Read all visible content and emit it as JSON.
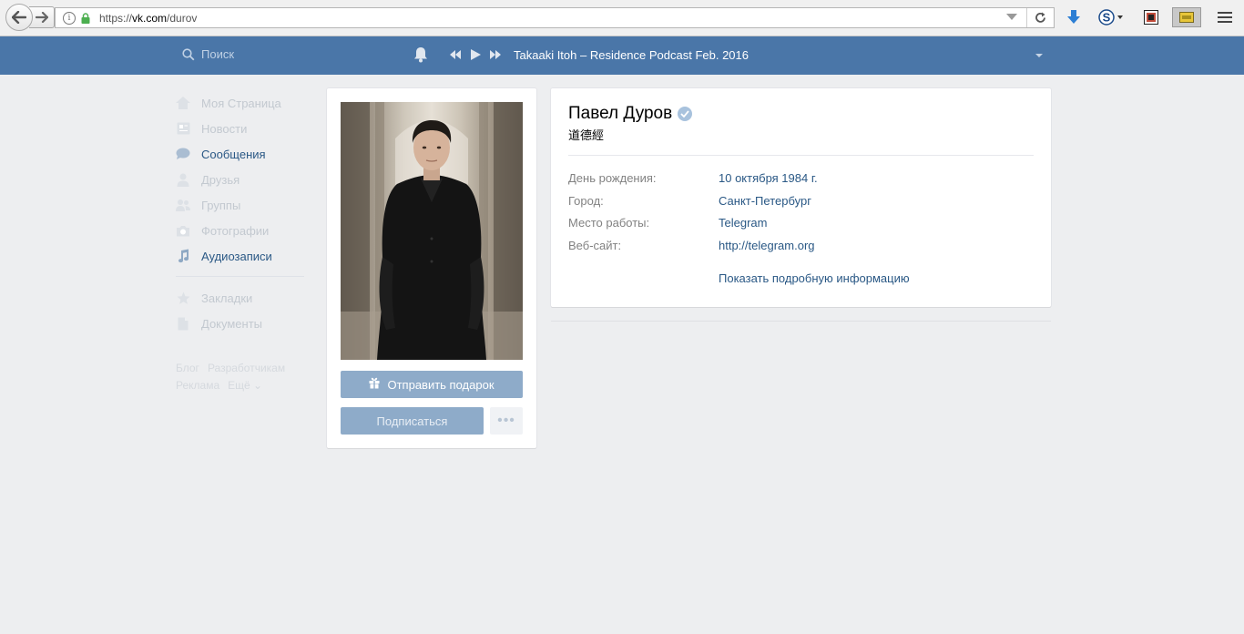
{
  "browser": {
    "url_scheme": "https://",
    "url_host": "vk.com",
    "url_path": "/durov"
  },
  "header": {
    "search_placeholder": "Поиск",
    "now_playing": "Takaaki Itoh – Residence Podcast Feb. 2016"
  },
  "menu": {
    "items": [
      {
        "label": "Моя Страница",
        "icon": "home-icon",
        "active": false
      },
      {
        "label": "Новости",
        "icon": "news-icon",
        "active": false
      },
      {
        "label": "Сообщения",
        "icon": "messages-icon",
        "active": true
      },
      {
        "label": "Друзья",
        "icon": "friends-icon",
        "active": false
      },
      {
        "label": "Группы",
        "icon": "groups-icon",
        "active": false
      },
      {
        "label": "Фотографии",
        "icon": "camera-icon",
        "active": false
      },
      {
        "label": "Аудиозаписи",
        "icon": "music-note-icon",
        "active": true
      }
    ],
    "items2": [
      {
        "label": "Закладки",
        "icon": "star-icon",
        "active": false
      },
      {
        "label": "Документы",
        "icon": "document-icon",
        "active": false
      }
    ],
    "footer": [
      "Блог",
      "Разработчикам",
      "Реклама",
      "Ещё ⌄"
    ]
  },
  "profile": {
    "gift_button": "Отправить подарок",
    "subscribe_button": "Подписаться",
    "more_button": "•••",
    "name": "Павел Дуров",
    "status": "道德經",
    "info": [
      {
        "label": "День рождения:",
        "value": "10 октября 1984 г."
      },
      {
        "label": "Город:",
        "value": "Санкт-Петербург"
      },
      {
        "label": "Место работы:",
        "value": "Telegram"
      },
      {
        "label": "Веб-сайт:",
        "value": "http://telegram.org"
      }
    ],
    "show_more": "Показать подробную информацию"
  },
  "colors": {
    "header_bg": "#4a76a8",
    "page_bg": "#edeef0",
    "link": "#2a5885",
    "button_bg": "#8eabc9"
  }
}
